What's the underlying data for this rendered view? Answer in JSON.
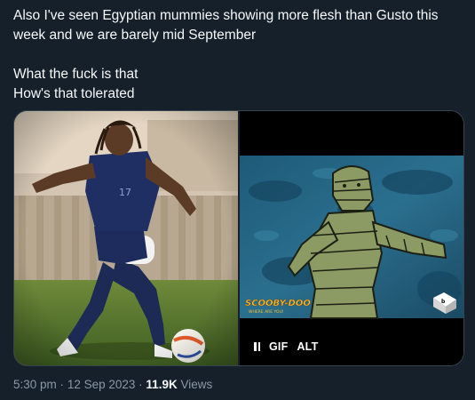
{
  "tweet": {
    "paragraph1": "Also I've seen Egyptian mummies showing more flesh than Gusto this week and we are barely mid September",
    "paragraph2_line1": "What the fuck is that",
    "paragraph2_line2": "How's that tolerated"
  },
  "media": {
    "photo": {
      "jersey_number": "17"
    },
    "gif": {
      "logo_title": "SCOOBY-DOO",
      "logo_subtitle": "WHERE ARE YOU!",
      "badge_text": "b",
      "gif_label": "GIF",
      "alt_label": "ALT"
    }
  },
  "meta": {
    "time": "5:30 pm",
    "separator": "·",
    "date": "12 Sep 2023",
    "separator2": "·",
    "views_count": "11.9K",
    "views_label": "Views"
  },
  "colors": {
    "background": "#15202b",
    "text_primary": "#f7f9f9",
    "text_secondary": "#8b98a5",
    "border": "#38444d"
  }
}
